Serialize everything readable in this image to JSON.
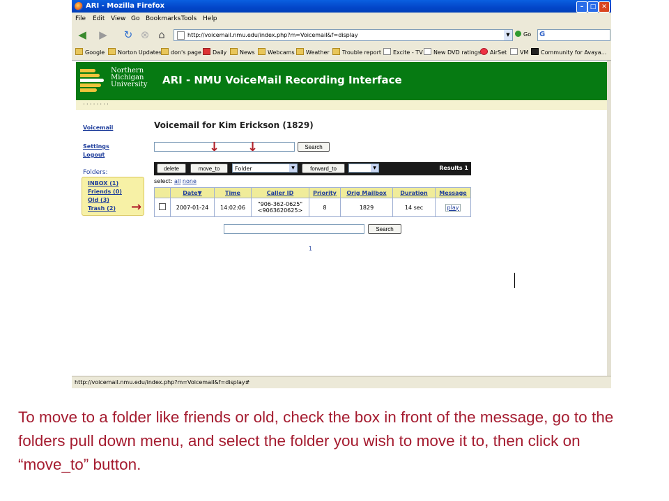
{
  "browser": {
    "window_title": "ARI - Mozilla Firefox",
    "menu": [
      "File",
      "Edit",
      "View",
      "Go",
      "Bookmarks",
      "Tools",
      "Help"
    ],
    "url": "http://voicemail.nmu.edu/index.php?m=Voicemail&f=display",
    "go_label": "Go",
    "search_engine_glyph": "G",
    "bookmarks": [
      "Google",
      "Norton Updates",
      "don's page",
      "Daily",
      "News",
      "Webcams",
      "Weather",
      "Trouble report",
      "Excite - TV",
      "New DVD ratings",
      "AirSet",
      "VM",
      "Community for Avaya..."
    ],
    "status_text": "http://voicemail.nmu.edu/index.php?m=Voicemail&f=display#"
  },
  "page": {
    "university_lines": [
      "Northern",
      "Michigan",
      "University"
    ],
    "title": "ARI - NMU VoiceMail Recording Interface",
    "dots": "........",
    "sidebar": {
      "voicemail_link": "Voicemail",
      "settings_link": "Settings",
      "logout_link": "Logout",
      "folders_label": "Folders:",
      "folders": [
        "INBOX (1)",
        "Friends (0)",
        "Old (3)",
        "Trash (2)"
      ]
    },
    "heading": "Voicemail for Kim Erickson (1829)",
    "search_button": "Search",
    "toolbar": {
      "delete": "delete",
      "move_to": "move_to",
      "folder_select": "Folder",
      "forward_to": "forward_to",
      "forward_select": "",
      "results": "Results 1"
    },
    "select_label": "select:",
    "select_all": "all",
    "select_none": "none",
    "table": {
      "headers": [
        "Date▼",
        "Time",
        "Caller ID",
        "Priority",
        "Orig Mailbox",
        "Duration",
        "Message"
      ],
      "row": {
        "date": "2007-01-24",
        "time": "14:02:06",
        "caller_id_line1": "\"906-362-0625\"",
        "caller_id_line2": "<9063620625>",
        "priority": "8",
        "orig_mailbox": "1829",
        "duration": "14 sec",
        "message": "play"
      }
    },
    "bottom_search_button": "Search",
    "page_number": "1"
  },
  "caption": "To move to a folder like friends or old, check the box in front of the message, go to the folders pull down menu, and select the folder you wish to move it to, then click on “move_to” button.",
  "colors": {
    "header_green": "#067a12",
    "caption_red": "#a51c30",
    "arrow_red": "#b0202a",
    "table_header_yellow": "#f0ec9a",
    "folder_box_yellow": "#f7f1a6"
  }
}
